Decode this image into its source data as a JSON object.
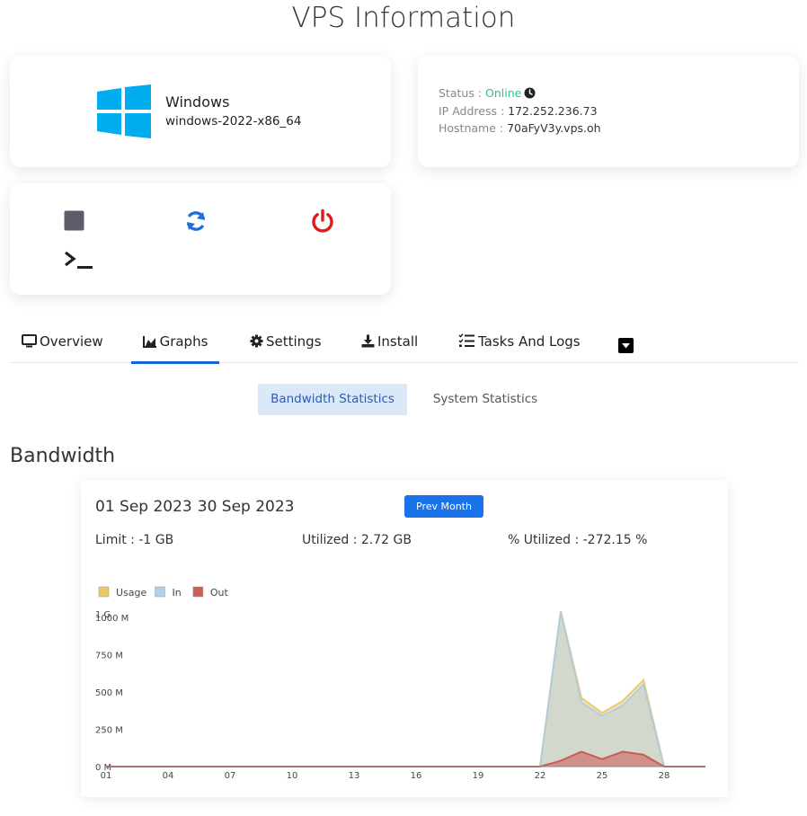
{
  "page": {
    "title": "VPS Information"
  },
  "os": {
    "name": "Windows",
    "version": "windows-2022-x86_64"
  },
  "info": {
    "status_label": "Status : ",
    "status_value": "Online",
    "ip_label": "IP Address : ",
    "ip_value": "172.252.236.73",
    "hostname_label": "Hostname : ",
    "hostname_value": "70aFyV3y.vps.oh"
  },
  "colors": {
    "accent": "#1565d8",
    "online": "#2bc48a",
    "power": "#e01b1b",
    "windows": "#00adef",
    "usage": "#e8c35a",
    "in": "#a9cbe8",
    "out": "#cc4b46"
  },
  "tabs": [
    {
      "label": "Overview",
      "icon": "monitor-icon"
    },
    {
      "label": "Graphs",
      "icon": "area-chart-icon",
      "active": true
    },
    {
      "label": "Settings",
      "icon": "gear-icon"
    },
    {
      "label": "Install",
      "icon": "download-icon"
    },
    {
      "label": "Tasks And Logs",
      "icon": "task-list-icon"
    }
  ],
  "subtabs": [
    {
      "label": "Bandwidth Statistics",
      "active": true
    },
    {
      "label": "System Statistics"
    }
  ],
  "bandwidth": {
    "heading": "Bandwidth",
    "start_date": "01 Sep 2023",
    "end_date": "30 Sep 2023",
    "prev_month_label": "Prev Month",
    "limit": "Limit : -1 GB",
    "utilized": "Utilized : 2.72 GB",
    "pct_utilized": "% Utilized : -272.15 %"
  },
  "chart_data": {
    "type": "area",
    "legend": [
      "Usage",
      "In",
      "Out"
    ],
    "legend_placement": "top-left",
    "y_ticks": [
      "0 M",
      "250 M",
      "500 M",
      "750 M",
      "1000 M",
      "1 G"
    ],
    "y_tick_values": [
      0,
      250,
      500,
      750,
      1000,
      1024
    ],
    "x_ticks": [
      "01",
      "04",
      "07",
      "10",
      "13",
      "16",
      "19",
      "22",
      "25",
      "28"
    ],
    "x_tick_values": [
      1,
      4,
      7,
      10,
      13,
      16,
      19,
      22,
      25,
      28
    ],
    "ylim": [
      0,
      1024
    ],
    "xlim": [
      1,
      30
    ],
    "x": [
      1,
      2,
      3,
      4,
      5,
      6,
      7,
      8,
      9,
      10,
      11,
      12,
      13,
      14,
      15,
      16,
      17,
      18,
      19,
      20,
      21,
      22,
      23,
      24,
      25,
      26,
      27,
      28,
      29,
      30
    ],
    "series": [
      {
        "name": "Usage",
        "values": [
          0,
          0,
          0,
          0,
          0,
          0,
          0,
          0,
          0,
          0,
          0,
          0,
          0,
          0,
          0,
          0,
          0,
          0,
          0,
          0,
          0,
          0,
          1040,
          460,
          360,
          440,
          580,
          0,
          0,
          0
        ]
      },
      {
        "name": "In",
        "values": [
          0,
          0,
          0,
          0,
          0,
          0,
          0,
          0,
          0,
          0,
          0,
          0,
          0,
          0,
          0,
          0,
          0,
          0,
          0,
          0,
          0,
          0,
          1040,
          430,
          340,
          410,
          550,
          0,
          0,
          0
        ]
      },
      {
        "name": "Out",
        "values": [
          0,
          0,
          0,
          0,
          0,
          0,
          0,
          0,
          0,
          0,
          0,
          0,
          0,
          0,
          0,
          0,
          0,
          0,
          0,
          0,
          0,
          0,
          40,
          100,
          50,
          100,
          80,
          0,
          0,
          0
        ]
      }
    ],
    "grid": false
  }
}
